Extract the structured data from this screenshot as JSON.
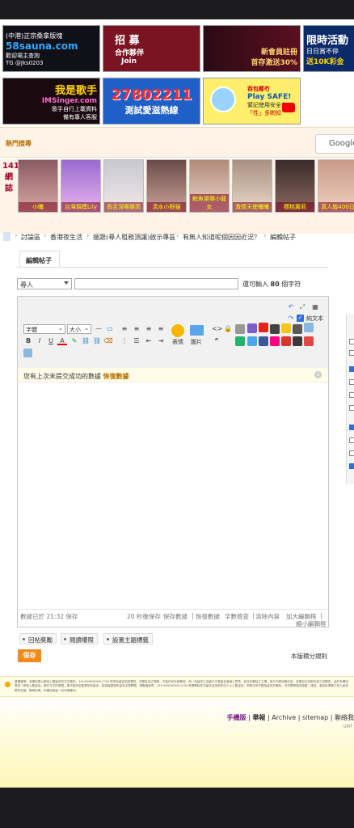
{
  "ads": {
    "sauna": {
      "line1": "(中港)正宗桑拿版塊",
      "line2": "58sauna.com",
      "line3": "歡迎場主查詢",
      "line4": "TG @Jks0203",
      "bg": "#101018",
      "accent": "#2fa7ff"
    },
    "recruit": {
      "line1": "招 募",
      "line2": "合作夥伴",
      "line3": "Join",
      "bg": "#7a1422"
    },
    "casino": {
      "line1": "新會員註冊",
      "line2": "首存激送30%",
      "bg": "#2a0a14"
    },
    "limited": {
      "line1": "限時活動",
      "line2": "日日賞不停",
      "line3": "送10K彩金",
      "bg": "#0a2a6a"
    },
    "singer": {
      "line1": "我是歌手",
      "line2": "IMSinger.com",
      "line3": "歌手自行上載資料",
      "line4": "備有專人客服",
      "bg": "#1a0a10"
    },
    "phone": {
      "line1": "27802211",
      "line2": "測試愛滋熱線",
      "bg": "#1f5fc8"
    },
    "safe": {
      "line1": "吞包都冇",
      "line2": "Play SAFE!",
      "line3": "緊記使用安全套",
      "line4": "「性」多啲知",
      "bg": "#ffef6a"
    }
  },
  "hot_search": {
    "label": "熱門搜尋",
    "google_placeholder": "Google"
  },
  "stars": {
    "side_label": "141網誌",
    "items": [
      {
        "name": "小曦"
      },
      {
        "name": "台灣靚模Lily"
      },
      {
        "name": "長舌深喉樂高"
      },
      {
        "name": "清水小野貓"
      },
      {
        "name": "鯨魚樂樂小龍女"
      },
      {
        "name": "激情天使曦曦"
      },
      {
        "name": "櫻桃蘿莉"
      },
      {
        "name": "真人版400日"
      }
    ]
  },
  "breadcrumb": {
    "items": [
      "討論區",
      "香港夜生活",
      "搵跟(尋人租務頂讓)啟示專區",
      "有無人知道呢個因因近況？",
      "編輯帖子"
    ]
  },
  "tabs": {
    "edit": "編輯帖子"
  },
  "form": {
    "type_value": "尋人",
    "title_value": "",
    "hint_prefix": "還可輸入",
    "hint_count": "80",
    "hint_suffix": "個字符"
  },
  "editor": {
    "font_select": "字體",
    "size_select": "大小",
    "plain_text_label": "純文本",
    "emoji_label": "表情",
    "image_label": "圖片",
    "quote_label": "“",
    "notice_text": "您有上次未提交成功的數據",
    "notice_link": "恢復數據",
    "status": {
      "saved": "數據已於 21:32 保存",
      "autosave": "20 秒後保存",
      "save_data": "保存數據",
      "restore_data": "恢復數據",
      "word_check": "字數檢查",
      "clear": "清除內容",
      "bigger": "加大編輯框",
      "smaller": "縮小編輯框",
      "sep": "|"
    }
  },
  "options": {
    "buttons": [
      "回帖獎勵",
      "閱讀權限",
      "設置主題標籤"
    ],
    "points_rule": "本版積分規則",
    "submit": "保存"
  },
  "disclaimer": "重要聲明：本網站是以即時上載留言的方式運作，141HONGKONG.COM 對所有留言的真實性、完整性及立場等，不負任何法律責任。而一切留言之言論只代表留言者個人意見，並非本網站之立場，用戶不應信賴內容，並應自行判斷內容之真實性。由於本網站受到「即時上載留言」運作方式所規限，故不能完全監察所有留言，若讀者發現有留言出現問題，請聯絡我們。141HONGKONG.COM 有權刪除任何留言及拒絕任何人士上載留言，同時亦有不刪除留言的權利。切勿撰寫粗言穢語、誹謗、渲染色情暴力或人身攻擊的言論，敬請自律。本網站保留一切法律權利。",
  "footer": {
    "mobile": "手機版",
    "report": "舉報",
    "archive": "Archive",
    "sitemap": "sitemap",
    "contact": "聯絡我",
    "sep": "|",
    "gmt": "GMT"
  },
  "colors": {
    "accent_orange": "#f08a1c",
    "brand_red": "#a4002a",
    "link_gold": "#b87000",
    "checkbox_blue": "#2f6fd8"
  }
}
